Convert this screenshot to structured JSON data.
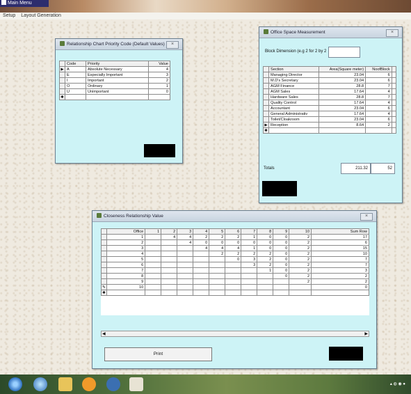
{
  "app": {
    "title": "Main Menu",
    "menu": [
      "Setup",
      "Layout Generation"
    ]
  },
  "priority_window": {
    "title": "Relationship Chart Priority Code (Default Values)",
    "columns": [
      "Code",
      "Priority",
      "Value"
    ],
    "rows": [
      [
        "A",
        "Absolute Necessary",
        "4"
      ],
      [
        "E",
        "Especially Important",
        "3"
      ],
      [
        "I",
        "Important",
        "2"
      ],
      [
        "O",
        "Ordinary",
        "1"
      ],
      [
        "U",
        "Unimportant",
        "0"
      ]
    ]
  },
  "space_window": {
    "title": "Office Space Measurement",
    "block_label": "Block Dimension (e.g 2 for 2 by 2",
    "block_value": "",
    "columns": [
      "Section",
      "Area(Square meter)",
      "NoofBlock"
    ],
    "rows": [
      [
        "Managing Director",
        "23.04",
        "6"
      ],
      [
        "M.D's Secretary",
        "23.04",
        "6"
      ],
      [
        "AGM Finance",
        "28.8",
        "7"
      ],
      [
        "AGM Sales",
        "17.64",
        "4"
      ],
      [
        "Hardware Sales",
        "28.8",
        "7"
      ],
      [
        "Quality Control",
        "17.64",
        "4"
      ],
      [
        "Accountant",
        "23.04",
        "6"
      ],
      [
        "General Administrativ",
        "17.64",
        "4"
      ],
      [
        "Toilet/Cloakroom",
        "23.04",
        "6"
      ],
      [
        "Reception",
        "8.64",
        "2"
      ]
    ],
    "totals_label": "Totals",
    "total_area": "211.32",
    "total_blocks": "52"
  },
  "closeness_window": {
    "title": "Closeness Relationship Value",
    "columns": [
      "Office",
      "1",
      "2",
      "3",
      "4",
      "5",
      "6",
      "7",
      "8",
      "9",
      "10",
      "Sum Row"
    ],
    "rows": [
      [
        "1",
        "",
        "4",
        "4",
        "2",
        "2",
        "2",
        "1",
        "0",
        "0",
        "2",
        "17"
      ],
      [
        "2",
        "",
        "",
        "4",
        "0",
        "0",
        "0",
        "0",
        "0",
        "0",
        "2",
        "6"
      ],
      [
        "3",
        "",
        "",
        "",
        "4",
        "4",
        "4",
        "1",
        "0",
        "0",
        "2",
        "15"
      ],
      [
        "4",
        "",
        "",
        "",
        "",
        "2",
        "2",
        "2",
        "2",
        "0",
        "2",
        "10"
      ],
      [
        "5",
        "",
        "",
        "",
        "",
        "",
        "0",
        "3",
        "2",
        "0",
        "2",
        "7"
      ],
      [
        "6",
        "",
        "",
        "",
        "",
        "",
        "",
        "3",
        "2",
        "0",
        "2",
        "7"
      ],
      [
        "7",
        "",
        "",
        "",
        "",
        "",
        "",
        "",
        "1",
        "0",
        "2",
        "3"
      ],
      [
        "8",
        "",
        "",
        "",
        "",
        "",
        "",
        "",
        "",
        "0",
        "2",
        "2"
      ],
      [
        "9",
        "",
        "",
        "",
        "",
        "",
        "",
        "",
        "",
        "",
        "2",
        "2"
      ],
      [
        "10",
        "",
        "",
        "",
        "",
        "",
        "",
        "",
        "",
        "",
        "",
        "0"
      ]
    ],
    "print_label": "Print"
  }
}
